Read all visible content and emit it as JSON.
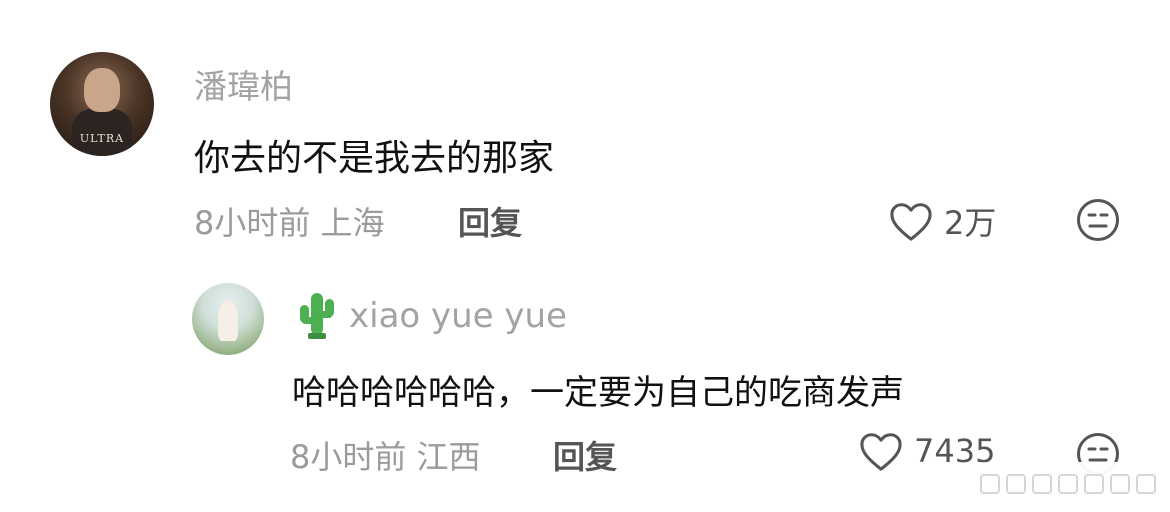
{
  "comments": [
    {
      "username": "潘瑋柏",
      "text": "你去的不是我去的那家",
      "meta": "8小时前 上海",
      "reply_label": "回复",
      "likes": "2万",
      "avatar_text": "ULTRA"
    },
    {
      "username_emoji": "🌵",
      "username": "xiao yue yue",
      "text": "哈哈哈哈哈哈，一定要为自己的吃商发声",
      "meta": "8小时前 江西",
      "reply_label": "回复",
      "likes": "7435"
    }
  ],
  "icons": {
    "like": "heart-outline-icon",
    "dislike": "meh-face-icon",
    "user_badge": "cactus-icon"
  },
  "colors": {
    "username": "#a3a3a3",
    "text": "#111111",
    "meta": "#9b9b9b",
    "reply": "#555555"
  }
}
